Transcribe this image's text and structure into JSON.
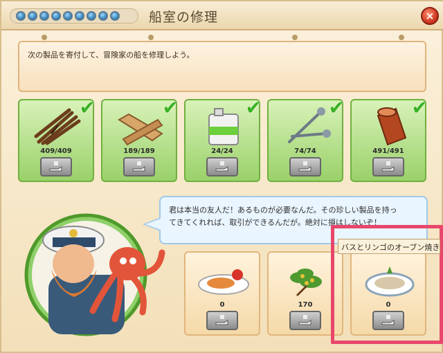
{
  "window": {
    "title": "船室の修理",
    "close_label": "×",
    "progress_dots": 9
  },
  "instruction": {
    "text": "次の製品を寄付して、冒険家の船を修理しよう。"
  },
  "materials": [
    {
      "name": "wood-sticks",
      "count": "409/409",
      "complete": true,
      "check": "✔"
    },
    {
      "name": "plank",
      "count": "189/189",
      "complete": true,
      "check": "✔"
    },
    {
      "name": "canister",
      "count": "24/24",
      "complete": true,
      "check": "✔"
    },
    {
      "name": "nails",
      "count": "74/74",
      "complete": true,
      "check": "✔"
    },
    {
      "name": "log",
      "count": "491/491",
      "complete": true,
      "check": "✔"
    }
  ],
  "dialog": {
    "line1": "君は本当の友人だ！あるものが必要なんだ。その珍しい製品を持っ",
    "line2": "てきてくれれば、取引ができるんだが。絶対に損はしないぞ！"
  },
  "products": [
    {
      "name": "baked-fish-plate",
      "count": "0"
    },
    {
      "name": "herb-bouquet",
      "count": "170"
    },
    {
      "name": "bass-apple-oven-bake",
      "count": "0"
    }
  ],
  "tooltip": {
    "text": "バスとリンゴのオーブン焼き"
  },
  "colors": {
    "accent_highlight": "#e8476b",
    "material_bg": "#9ad16a",
    "check": "#39b224",
    "close_button": "#c9301b"
  }
}
